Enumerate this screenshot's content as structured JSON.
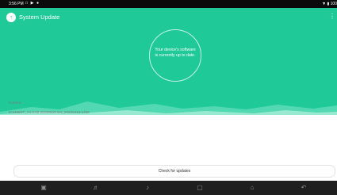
{
  "status_bar": {
    "time": "3:56 PM",
    "icons": [
      "message-icon",
      "play-icon",
      "settings-icon"
    ],
    "battery_text": "100"
  },
  "app_bar": {
    "title": "System Update",
    "app_icon": "update-icon",
    "menu_icon": "more-vert-icon"
  },
  "status": {
    "message_line1": "Your device's software",
    "message_line2": "is currently up to date."
  },
  "info": {
    "label": "Current",
    "version": "IC4458ST_V1.0.02.2023050X.EN_20220413-1458"
  },
  "actions": {
    "check_label": "Check for updates"
  },
  "nav_bar": {
    "buttons": [
      "screenshot-icon",
      "volume-down-icon",
      "volume-up-icon",
      "recent-apps-icon",
      "home-icon",
      "back-icon"
    ]
  },
  "colors": {
    "primary": "#1fc998",
    "status_bar": "#0b0b0b",
    "nav_bar": "#1f1f1f"
  }
}
